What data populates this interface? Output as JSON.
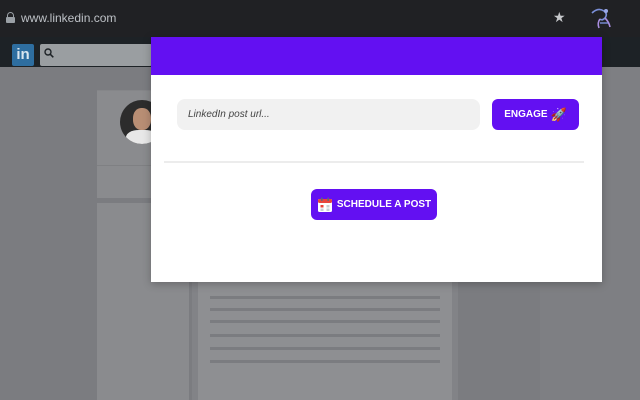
{
  "browser": {
    "url": "www.linkedin.com",
    "icons": {
      "lock": "lock-icon",
      "bookmark": "star-icon",
      "extension": "extension-logo-icon"
    }
  },
  "linkedin": {
    "logo_text": "in",
    "icons": {
      "search": "search-icon"
    }
  },
  "modal": {
    "header_color": "#6310f2",
    "post_url_input": {
      "value": "",
      "placeholder": "LinkedIn post url..."
    },
    "engage_button": {
      "label": "ENGAGE",
      "icon": "rocket-icon"
    },
    "schedule_button": {
      "label": "SCHEDULE A POST",
      "icon": "calendar-icon"
    }
  },
  "colors": {
    "accent": "#6310f2",
    "overlay": "#7b7c80",
    "chrome": "#202124"
  }
}
